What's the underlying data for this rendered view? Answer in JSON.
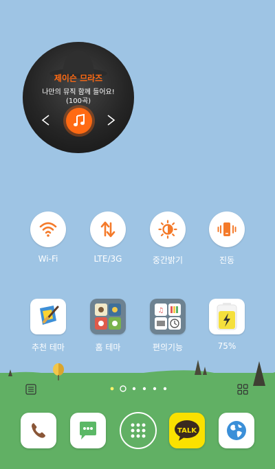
{
  "music_widget": {
    "artist": "제이슨 므라즈",
    "slogan": "나만의 뮤직 함께 들어요!",
    "track_count": "(100곡)"
  },
  "toggles": [
    {
      "label": "Wi-Fi",
      "icon": "wifi-icon"
    },
    {
      "label": "LTE/3G",
      "icon": "data-transfer-icon"
    },
    {
      "label": "중간밝기",
      "icon": "brightness-icon"
    },
    {
      "label": "진동",
      "icon": "vibrate-icon"
    }
  ],
  "apps": [
    {
      "label": "추천 테마",
      "icon": "theme-brush-icon"
    },
    {
      "label": "홈 테마",
      "icon": "home-theme-icon"
    },
    {
      "label": "편의기능",
      "icon": "utilities-icon"
    },
    {
      "label": "75%",
      "icon": "battery-icon"
    }
  ],
  "battery_level": 0.75,
  "page_indicator": {
    "count": 6,
    "current": 1
  },
  "dock": [
    {
      "name": "phone",
      "icon": "phone-icon"
    },
    {
      "name": "messages",
      "icon": "message-icon"
    },
    {
      "name": "app-drawer",
      "icon": "app-drawer-icon"
    },
    {
      "name": "kakaotalk",
      "icon": "talk-icon",
      "text": "TALK"
    },
    {
      "name": "browser",
      "icon": "globe-icon"
    }
  ],
  "colors": {
    "sky": "#9ec4e4",
    "accent": "#ff6a13",
    "grass": "#61b064",
    "kakao_yellow": "#fae100"
  }
}
